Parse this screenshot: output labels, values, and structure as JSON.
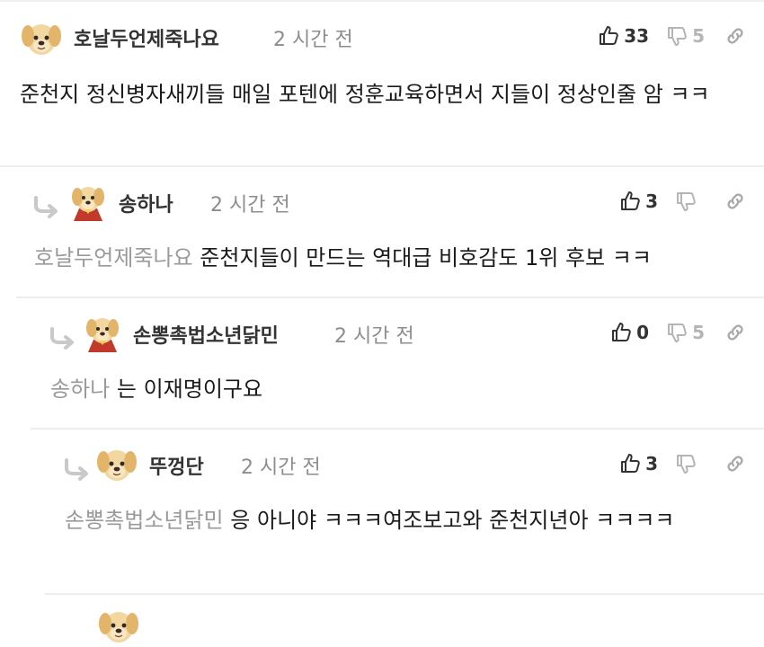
{
  "comments": [
    {
      "nickname": "호날두언제죽나요",
      "time": "2 시간 전",
      "likes": "33",
      "dislikes": "5",
      "mention": "",
      "text": "준천지 정신병자새끼들 매일 포텐에 정훈교육하면서 지들이 정상인줄 암 ㅋㅋ",
      "avatar": "puppy-avatar"
    },
    {
      "nickname": "송하나",
      "time": "2 시간 전",
      "likes": "3",
      "dislikes": "",
      "mention": "호날두언제죽나요",
      "text": "준천지들이 만드는 역대급 비호감도 1위 후보 ㅋㅋ",
      "avatar": "puppy-red-avatar"
    },
    {
      "nickname": "손뽕촉법소년닭민",
      "time": "2 시간 전",
      "likes": "0",
      "dislikes": "5",
      "mention": "송하나",
      "text": "는 이재명이구요",
      "avatar": "puppy-red-avatar"
    },
    {
      "nickname": "뚜껑단",
      "time": "2 시간 전",
      "likes": "3",
      "dislikes": "",
      "mention": "손뽕촉법소년닭민",
      "text": "응 아니야 ㅋㅋㅋ여조보고와 준천지년아 ㅋㅋㅋㅋ",
      "avatar": "puppy-avatar"
    }
  ],
  "colors": {
    "accent_text": "#222222",
    "muted": "#8d8d8d",
    "mention": "#9a9a9a",
    "dislike": "#b5b5b5"
  }
}
